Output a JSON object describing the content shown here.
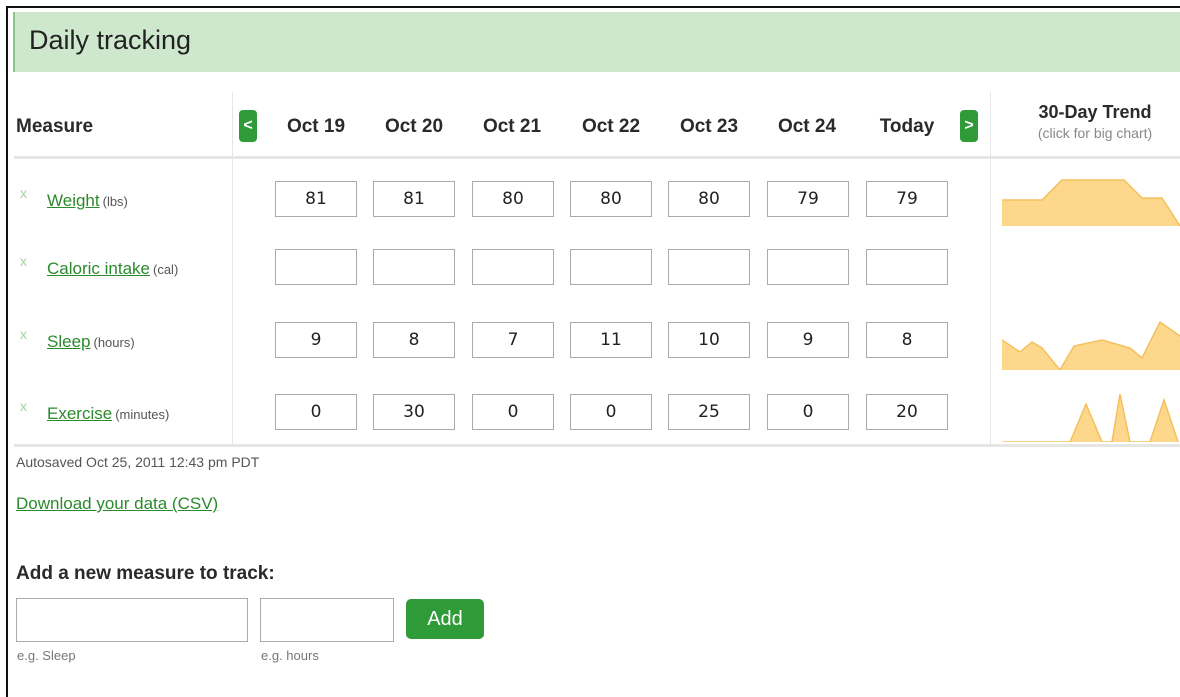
{
  "header": {
    "title": "Daily tracking"
  },
  "table": {
    "measure_header": "Measure",
    "prev_label": "<",
    "next_label": ">",
    "dates": [
      "Oct 19",
      "Oct 20",
      "Oct 21",
      "Oct 22",
      "Oct 23",
      "Oct 24",
      "Today"
    ],
    "trend_title": "30-Day Trend",
    "trend_subtitle": "(click for big chart)",
    "remove_label": "x",
    "rows": [
      {
        "name": "Weight",
        "unit": "(lbs)",
        "values": [
          "81",
          "81",
          "80",
          "80",
          "80",
          "79",
          "79"
        ]
      },
      {
        "name": "Caloric intake",
        "unit": "(cal)",
        "values": [
          "",
          "",
          "",
          "",
          "",
          "",
          ""
        ]
      },
      {
        "name": "Sleep",
        "unit": "(hours)",
        "values": [
          "9",
          "8",
          "7",
          "11",
          "10",
          "9",
          "8"
        ]
      },
      {
        "name": "Exercise",
        "unit": "(minutes)",
        "values": [
          "0",
          "30",
          "0",
          "0",
          "25",
          "0",
          "20"
        ]
      }
    ]
  },
  "footer": {
    "autosaved": "Autosaved Oct 25, 2011 12:43 pm PDT",
    "download_link": "Download your data (CSV)"
  },
  "add_measure": {
    "heading": "Add a new measure to track:",
    "name_value": "",
    "unit_value": "",
    "name_hint": "e.g. Sleep",
    "unit_hint": "e.g. hours",
    "button_label": "Add"
  },
  "colors": {
    "header_bg": "#cde8cd",
    "accent_green": "#2e9a38",
    "link_green": "#2b8a2b",
    "sparkline_fill": "#fdd88c",
    "sparkline_stroke": "#f5bf5a"
  }
}
